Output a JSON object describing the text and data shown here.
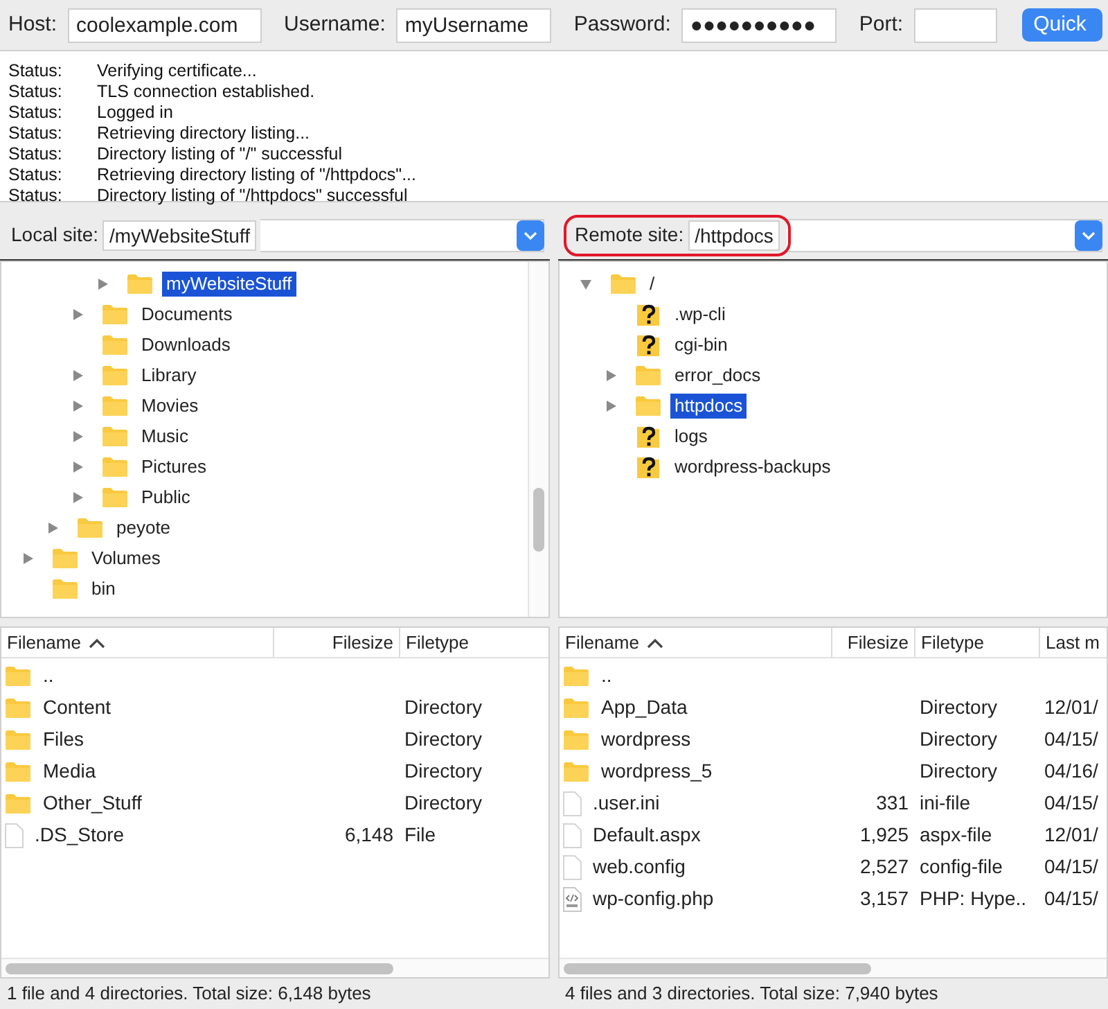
{
  "toolbar": {
    "fields": [
      {
        "label": "Host:",
        "value": "coolexample.com"
      },
      {
        "label": "Username:",
        "value": "myUsername"
      },
      {
        "label": "Password:",
        "value": "●●●●●●●●●●"
      },
      {
        "label": "Port:"
      }
    ],
    "quickconnect": "Quick"
  },
  "log": [
    {
      "label": "Status:",
      "message": "Verifying certificate..."
    },
    {
      "label": "Status:",
      "message": "TLS connection established."
    },
    {
      "label": "Status:",
      "message": "Logged in"
    },
    {
      "label": "Status:",
      "message": "Retrieving directory listing..."
    },
    {
      "label": "Status:",
      "message": "Directory listing of \"/\" successful"
    },
    {
      "label": "Status:",
      "message": "Retrieving directory listing of \"/httpdocs\"..."
    },
    {
      "label": "Status:",
      "message": "Directory listing of \"/httpdocs\" successful"
    }
  ],
  "panes": [
    {
      "site": {
        "label": "Local site:",
        "path": "/myWebsiteStuff",
        "highlighted": false
      },
      "tree": [
        {
          "children": [
            {
              "children": [
                {
                  "children": [
                    {
                      "label": "myWebsiteStuff",
                      "kind": "folder",
                      "expandable": true,
                      "expanded": false,
                      "selected": true
                    }
                  ]
                },
                {
                  "label": "Documents",
                  "kind": "folder",
                  "expandable": true,
                  "expanded": false,
                  "selected": false
                },
                {
                  "label": "Downloads",
                  "kind": "folder",
                  "expandable": false,
                  "selected": false
                },
                {
                  "label": "Library",
                  "kind": "folder",
                  "expandable": true,
                  "expanded": false,
                  "selected": false
                },
                {
                  "label": "Movies",
                  "kind": "folder",
                  "expandable": true,
                  "expanded": false,
                  "selected": false
                },
                {
                  "label": "Music",
                  "kind": "folder",
                  "expandable": true,
                  "expanded": false,
                  "selected": false
                },
                {
                  "label": "Pictures",
                  "kind": "folder",
                  "expandable": true,
                  "expanded": false,
                  "selected": false
                },
                {
                  "label": "Public",
                  "kind": "folder",
                  "expandable": true,
                  "expanded": false,
                  "selected": false
                }
              ]
            },
            {
              "label": "peyote",
              "kind": "folder",
              "expandable": true,
              "expanded": false,
              "selected": false
            }
          ]
        },
        {
          "label": "Volumes",
          "kind": "folder",
          "expandable": true,
          "expanded": false,
          "selected": false
        },
        {
          "label": "bin",
          "kind": "folder",
          "expandable": false,
          "selected": false
        }
      ],
      "columns": [
        "Filename",
        "Filesize",
        "Filetype"
      ],
      "rows": [
        {
          "kind": "folder",
          "cells": [
            "..",
            "",
            ""
          ]
        },
        {
          "kind": "folder",
          "cells": [
            "Content",
            "",
            "Directory"
          ]
        },
        {
          "kind": "folder",
          "cells": [
            "Files",
            "",
            "Directory"
          ]
        },
        {
          "kind": "folder",
          "cells": [
            "Media",
            "",
            "Directory"
          ]
        },
        {
          "kind": "folder",
          "cells": [
            "Other_Stuff",
            "",
            "Directory"
          ]
        },
        {
          "kind": "file",
          "cells": [
            ".DS_Store",
            "6,148",
            "File"
          ]
        }
      ],
      "status": "1 file and 4 directories. Total size: 6,148 bytes"
    },
    {
      "site": {
        "label": "Remote site:",
        "path": "/httpdocs",
        "highlighted": true
      },
      "tree": [
        {
          "label": "/",
          "kind": "folder",
          "expandable": true,
          "expanded": true,
          "selected": false,
          "children": [
            {
              "label": ".wp-cli",
              "kind": "unknown",
              "expandable": false,
              "selected": false
            },
            {
              "label": "cgi-bin",
              "kind": "unknown",
              "expandable": false,
              "selected": false
            },
            {
              "label": "error_docs",
              "kind": "folder",
              "expandable": true,
              "expanded": false,
              "selected": false
            },
            {
              "label": "httpdocs",
              "kind": "folder",
              "expandable": true,
              "expanded": false,
              "selected": true
            },
            {
              "label": "logs",
              "kind": "unknown",
              "expandable": false,
              "selected": false
            },
            {
              "label": "wordpress-backups",
              "kind": "unknown",
              "expandable": false,
              "selected": false
            }
          ]
        }
      ],
      "columns": [
        "Filename",
        "Filesize",
        "Filetype",
        "Last m"
      ],
      "rows": [
        {
          "kind": "folder",
          "cells": [
            "..",
            "",
            "",
            ""
          ]
        },
        {
          "kind": "folder",
          "cells": [
            "App_Data",
            "",
            "Directory",
            "12/01/"
          ]
        },
        {
          "kind": "folder",
          "cells": [
            "wordpress",
            "",
            "Directory",
            "04/15/"
          ]
        },
        {
          "kind": "folder",
          "cells": [
            "wordpress_5",
            "",
            "Directory",
            "04/16/"
          ]
        },
        {
          "kind": "file",
          "cells": [
            ".user.ini",
            "331",
            "ini-file",
            "04/15/"
          ]
        },
        {
          "kind": "file",
          "cells": [
            "Default.aspx",
            "1,925",
            "aspx-file",
            "12/01/"
          ]
        },
        {
          "kind": "file",
          "cells": [
            "web.config",
            "2,527",
            "config-file",
            "04/15/"
          ]
        },
        {
          "kind": "php",
          "cells": [
            "wp-config.php",
            "3,157",
            "PHP: Hype..",
            "04/15/"
          ]
        }
      ],
      "status": "4 files and 3 directories. Total size: 7,940 bytes"
    }
  ]
}
